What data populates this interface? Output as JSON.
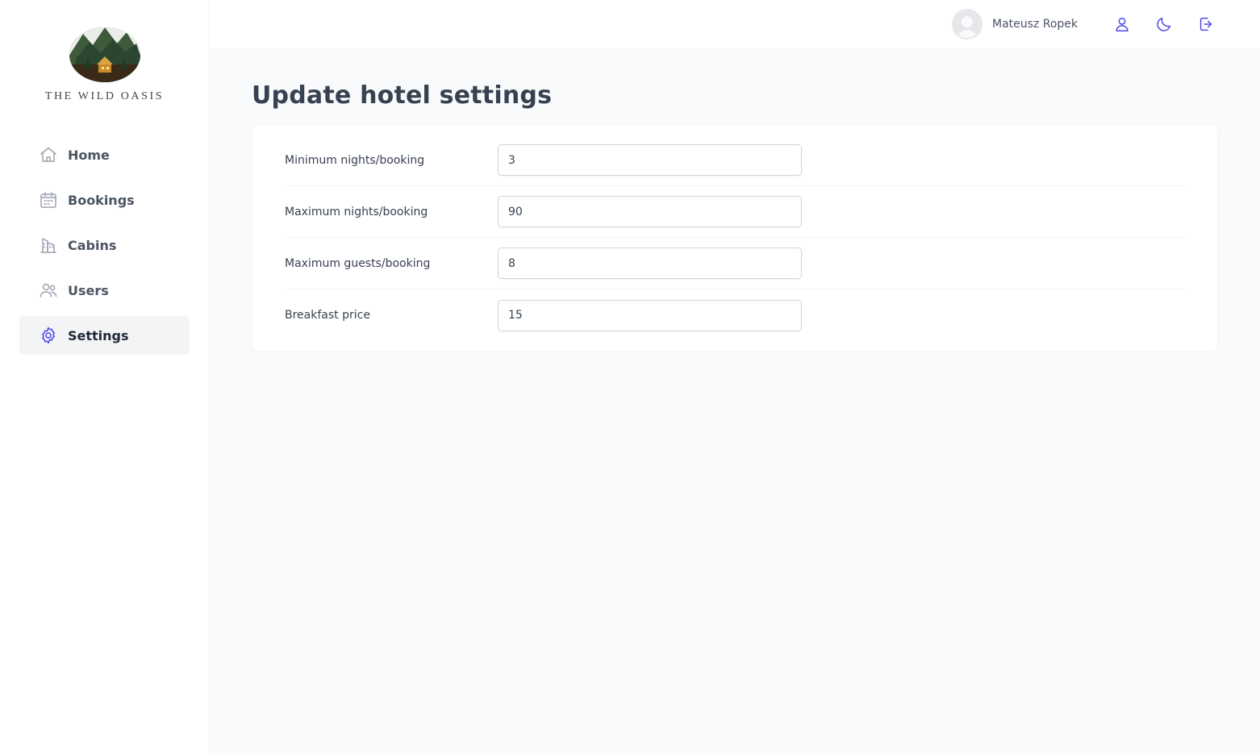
{
  "brand": {
    "name": "THE WILD OASIS"
  },
  "sidebar": {
    "items": [
      {
        "label": "Home",
        "icon": "home-icon",
        "active": false
      },
      {
        "label": "Bookings",
        "icon": "calendar-icon",
        "active": false
      },
      {
        "label": "Cabins",
        "icon": "building-icon",
        "active": false
      },
      {
        "label": "Users",
        "icon": "users-icon",
        "active": false
      },
      {
        "label": "Settings",
        "icon": "gear-icon",
        "active": true
      }
    ]
  },
  "header": {
    "user_name": "Mateusz Ropek",
    "actions": [
      "user-icon",
      "moon-icon",
      "logout-icon"
    ]
  },
  "page": {
    "title": "Update hotel settings"
  },
  "settings": {
    "fields": [
      {
        "label": "Minimum nights/booking",
        "value": "3"
      },
      {
        "label": "Maximum nights/booking",
        "value": "90"
      },
      {
        "label": "Maximum guests/booking",
        "value": "8"
      },
      {
        "label": "Breakfast price",
        "value": "15"
      }
    ]
  },
  "colors": {
    "accent": "#4f46e5",
    "background": "#f9fafb",
    "surface": "#ffffff",
    "text": "#374151"
  }
}
